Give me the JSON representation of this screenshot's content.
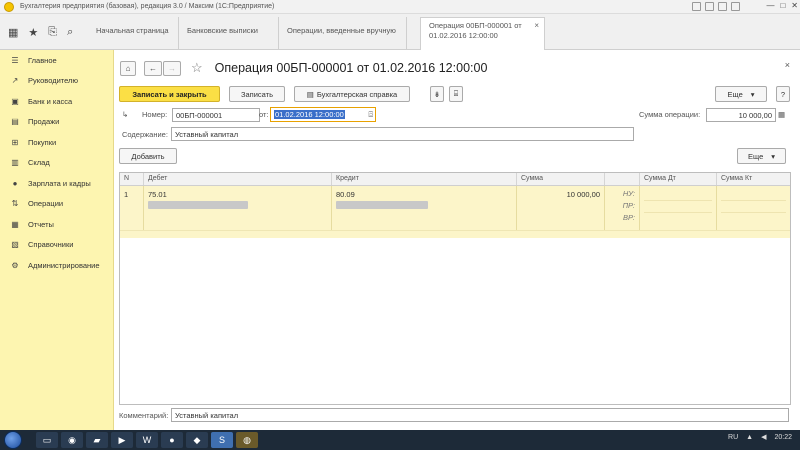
{
  "window": {
    "title": "Бухгалтерия предприятия (базовая), редакция 3.0 / Максим  (1С:Предприятие)",
    "controls": [
      "—",
      "□",
      "✕"
    ]
  },
  "tabs": [
    {
      "label": "Начальная страница"
    },
    {
      "label": "Банковские выписки"
    },
    {
      "label": "Операции, введенные вручную"
    },
    {
      "label_line1": "Операция 00БП-000001 от",
      "label_line2": "01.02.2016 12:00:00",
      "close": "×"
    }
  ],
  "sidebar": {
    "items": [
      {
        "label": "Главное",
        "icon": "menu-icon"
      },
      {
        "label": "Руководителю",
        "icon": "chart-icon"
      },
      {
        "label": "Банк и касса",
        "icon": "bank-icon"
      },
      {
        "label": "Продажи",
        "icon": "cart-icon"
      },
      {
        "label": "Покупки",
        "icon": "basket-icon"
      },
      {
        "label": "Склад",
        "icon": "warehouse-icon"
      },
      {
        "label": "Зарплата и кадры",
        "icon": "people-icon"
      },
      {
        "label": "Операции",
        "icon": "operations-icon"
      },
      {
        "label": "Отчеты",
        "icon": "reports-icon"
      },
      {
        "label": "Справочники",
        "icon": "book-icon"
      },
      {
        "label": "Администрирование",
        "icon": "gear-icon"
      }
    ]
  },
  "header": {
    "title": "Операция 00БП-000001 от 01.02.2016 12:00:00",
    "home": "⌂",
    "back": "←",
    "forward": "→",
    "star": "☆",
    "close": "×"
  },
  "toolbar": {
    "post_close": "Записать и закрыть",
    "save": "Записать",
    "accounting_ref": "Бухгалтерская справка",
    "more": "Еще",
    "help": "?"
  },
  "form": {
    "number_label": "Номер:",
    "number_value": "00БП-000001",
    "date_label": "от:",
    "date_value": "01.02.2016 12:00:00",
    "amount_label": "Сумма операции:",
    "amount_value": "10 000,00",
    "content_label": "Содержание:",
    "content_value": "Уставный капитал",
    "comment_label": "Комментарий:",
    "comment_value": "Уставный капитал"
  },
  "table_toolbar": {
    "add": "Добавить",
    "more": "Еще"
  },
  "table": {
    "columns": [
      "N",
      "Дебет",
      "Кредит",
      "Сумма",
      "",
      "Сумма Дт",
      "Сумма Кт"
    ],
    "rows": [
      {
        "n": "1",
        "debit": "75.01",
        "credit": "80.09",
        "amount": "10 000,00",
        "markers": [
          "НУ:",
          "ПР:",
          "ВР:"
        ]
      }
    ]
  },
  "taskbar": {
    "lang": "RU",
    "time": "20:22"
  }
}
